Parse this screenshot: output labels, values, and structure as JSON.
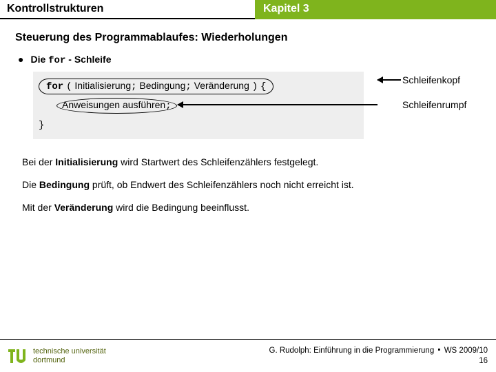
{
  "header": {
    "left": "Kontrollstrukturen",
    "right": "Kapitel 3"
  },
  "section_title": "Steuerung des Programmablaufes: Wiederholungen",
  "bullet": {
    "prefix": "Die",
    "keyword": "for",
    "suffix": "- Schleife"
  },
  "code": {
    "kw_for": "for",
    "lparen": "(",
    "init": "Initialisierung",
    "semi": ";",
    "cond": "Bedingung",
    "chg": "Veränderung",
    "rparen": ")",
    "lbrace": "{",
    "stmt": "Anweisungen ausführen",
    "rbrace": "}"
  },
  "labels": {
    "head": "Schleifenkopf",
    "body": "Schleifenrumpf"
  },
  "paras": {
    "p1a": "Bei der ",
    "p1b": "Initialisierung",
    "p1c": " wird Startwert des Schleifenzählers festgelegt.",
    "p2a": "Die ",
    "p2b": "Bedingung",
    "p2c": " prüft, ob Endwert des Schleifenzählers noch nicht erreicht ist.",
    "p3a": "Mit der ",
    "p3b": "Veränderung",
    "p3c": " wird die Bedingung beeinflusst."
  },
  "footer": {
    "uni1": "technische universität",
    "uni2": "dortmund",
    "credit": "G. Rudolph: Einführung in die Programmierung",
    "sep": "▪",
    "term": "WS 2009/10",
    "page": "16"
  }
}
